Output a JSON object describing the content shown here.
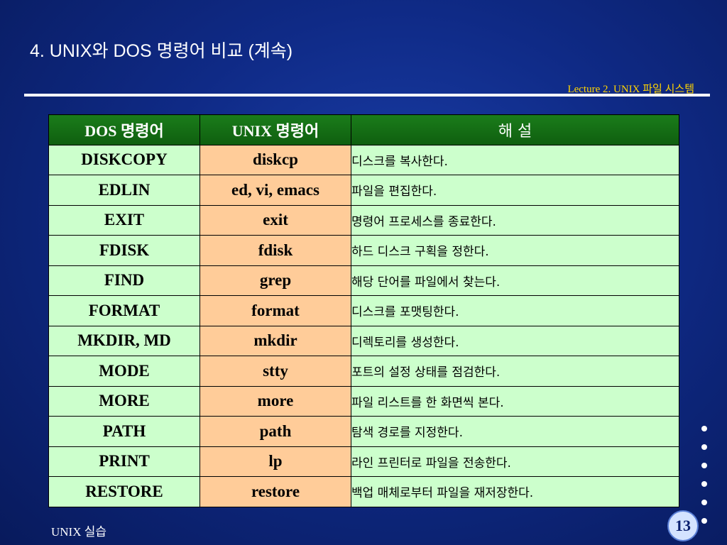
{
  "slide": {
    "title": "4. UNIX와 DOS 명령어 비교 (계속)",
    "lecture": "Lecture 2. UNIX 파일 시스템",
    "footer": "UNIX 실습",
    "page_number": "13"
  },
  "table": {
    "headers": [
      "DOS 명령어",
      "UNIX 명령어",
      "해 설"
    ],
    "rows": [
      {
        "dos": "DISKCOPY",
        "unix": "diskcp",
        "desc": "디스크를 복사한다."
      },
      {
        "dos": "EDLIN",
        "unix": "ed, vi, emacs",
        "desc": "파일을 편집한다."
      },
      {
        "dos": "EXIT",
        "unix": "exit",
        "desc": "명령어 프로세스를 종료한다."
      },
      {
        "dos": "FDISK",
        "unix": "fdisk",
        "desc": "하드 디스크 구획을 정한다."
      },
      {
        "dos": "FIND",
        "unix": "grep",
        "desc": "해당 단어를 파일에서 찾는다."
      },
      {
        "dos": "FORMAT",
        "unix": "format",
        "desc": "디스크를 포맷팅한다."
      },
      {
        "dos": "MKDIR, MD",
        "unix": "mkdir",
        "desc": "디렉토리를 생성한다."
      },
      {
        "dos": "MODE",
        "unix": "stty",
        "desc": "포트의 설정 상태를 점검한다."
      },
      {
        "dos": "MORE",
        "unix": "more",
        "desc": "파일 리스트를 한 화면씩 본다."
      },
      {
        "dos": "PATH",
        "unix": "path",
        "desc": "탐색 경로를 지정한다."
      },
      {
        "dos": "PRINT",
        "unix": "lp",
        "desc": "라인 프린터로 파일을 전송한다."
      },
      {
        "dos": "RESTORE",
        "unix": "restore",
        "desc": "백업 매체로부터 파일을 재저장한다."
      }
    ]
  },
  "colors": {
    "background": "#0f2a86",
    "header_green": "#1a7c1a",
    "dos_cell": "#ccffcc",
    "unix_cell": "#ffcc99",
    "lecture_text": "#ffd400"
  }
}
